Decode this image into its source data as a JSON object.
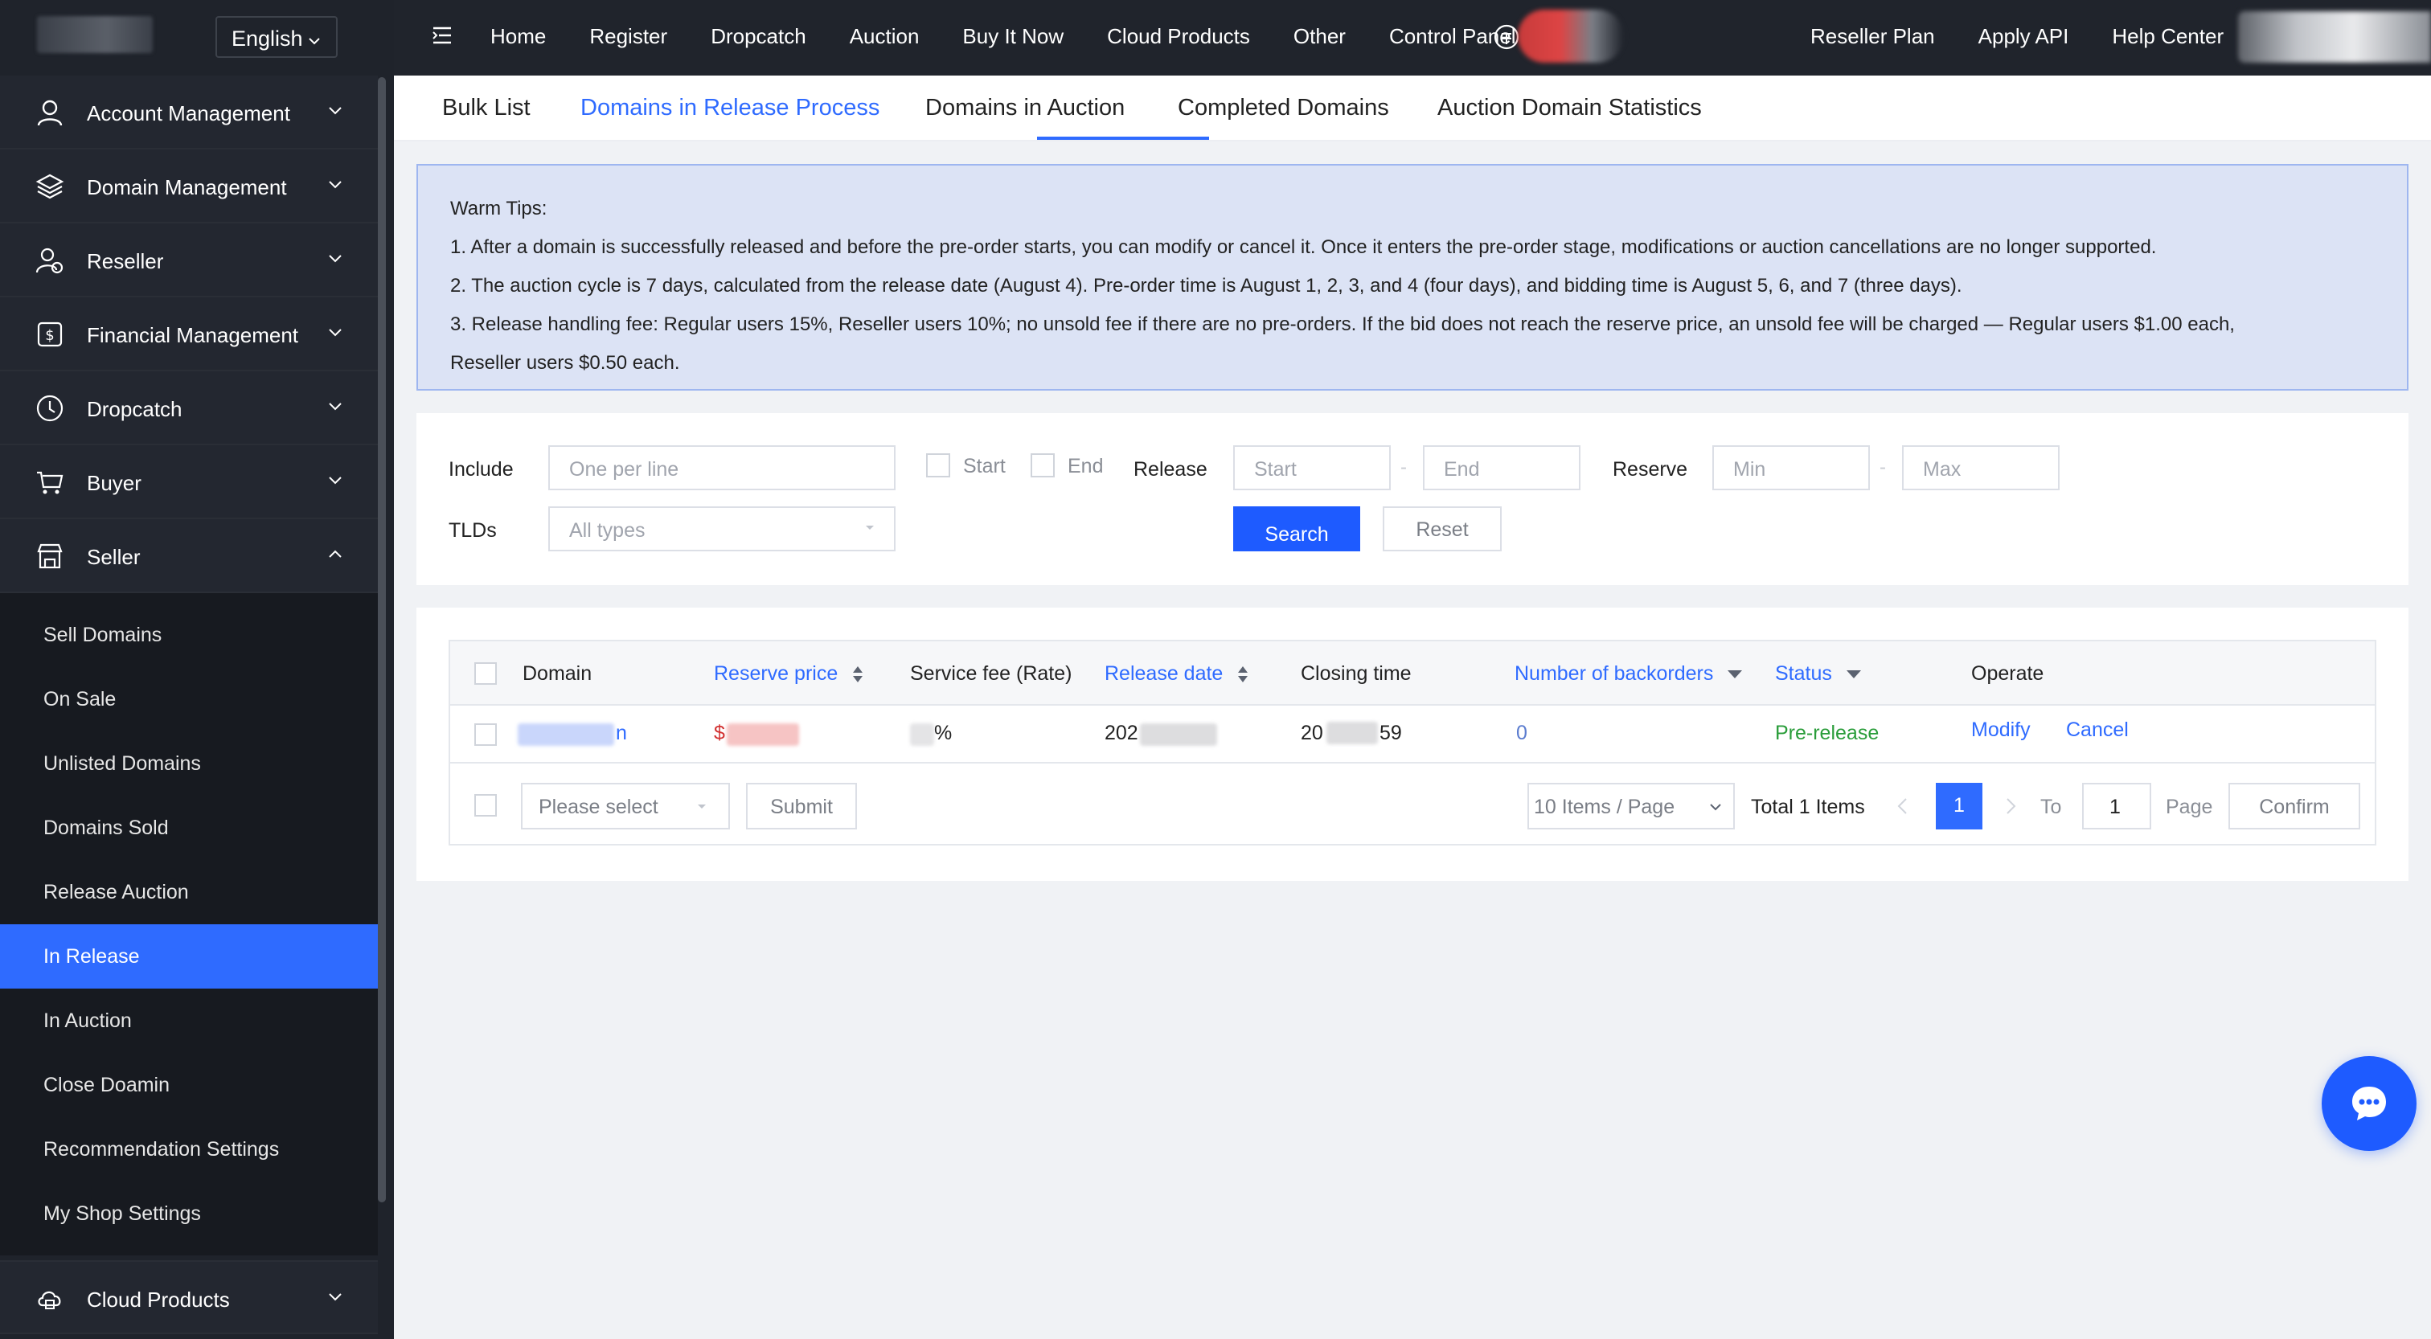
{
  "sidebar": {
    "language": "English",
    "groups": [
      {
        "label": "Account Management",
        "icon": "user-icon"
      },
      {
        "label": "Domain Management",
        "icon": "layers-icon"
      },
      {
        "label": "Reseller",
        "icon": "reseller-icon"
      },
      {
        "label": "Financial Management",
        "icon": "dollar-icon"
      },
      {
        "label": "Dropcatch",
        "icon": "clock-icon"
      },
      {
        "label": "Buyer",
        "icon": "cart-icon"
      },
      {
        "label": "Seller",
        "icon": "store-icon"
      }
    ],
    "seller_items": [
      "Sell Domains",
      "On Sale",
      "Unlisted Domains",
      "Domains Sold",
      "Release Auction",
      "In Release",
      "In Auction",
      "Close Doamin",
      "Recommendation Settings",
      "My Shop Settings"
    ],
    "active_item": "In Release",
    "bottom_group": {
      "label": "Cloud Products",
      "icon": "cloud-icon"
    }
  },
  "topbar": {
    "nav": [
      "Home",
      "Register",
      "Dropcatch",
      "Auction",
      "Buy It Now",
      "Cloud Products",
      "Other",
      "Control Panel"
    ],
    "right": [
      "Reseller Plan",
      "Apply API",
      "Help Center"
    ]
  },
  "tabs": [
    "Bulk List",
    "Domains in Release Process",
    "Domains in Auction",
    "Completed Domains",
    "Auction Domain Statistics"
  ],
  "active_tab": "Domains in Release Process",
  "tips": {
    "title": "Warm Tips:",
    "lines": [
      "1. After a domain is successfully released and before the pre-order starts, you can modify or cancel it. Once it enters the pre-order stage, modifications or auction cancellations are no longer supported.",
      "2. The auction cycle is 7 days, calculated from the release date (August 4). Pre-order time is August 1, 2, 3, and 4 (four days), and bidding time is August 5, 6, and 7 (three days).",
      "3. Release handling fee: Regular users 15%, Reseller users 10%; no unsold fee if there are no pre-orders. If the bid does not reach the reserve price, an unsold fee will be charged — Regular users $1.00 each,",
      "Reseller users $0.50 each."
    ]
  },
  "filters": {
    "include_label": "Include",
    "include_placeholder": "One per line",
    "start_check": "Start",
    "end_check": "End",
    "release_label": "Release",
    "release_start": "Start",
    "release_end": "End",
    "reserve_label": "Reserve",
    "reserve_min": "Min",
    "reserve_max": "Max",
    "tlds_label": "TLDs",
    "tlds_value": "All types",
    "search": "Search",
    "reset": "Reset",
    "dash": "-"
  },
  "table": {
    "columns": [
      "Domain",
      "Reserve price",
      "Service fee (Rate)",
      "Release date",
      "Closing time",
      "Number of backorders",
      "Status",
      "Operate"
    ],
    "rows": [
      {
        "domain_suffix": "n",
        "reserve_prefix": "$",
        "fee_suffix": "%",
        "release_prefix": "202",
        "closing_prefix": "20",
        "closing_suffix": "59",
        "backorders": "0",
        "status": "Pre-release",
        "modify": "Modify",
        "cancel": "Cancel"
      }
    ],
    "footer": {
      "bulk_placeholder": "Please select",
      "submit": "Submit",
      "page_size": "10 Items / Page",
      "total": "Total 1 Items",
      "current_page": "1",
      "to_label": "To",
      "goto_value": "1",
      "page_label": "Page",
      "confirm": "Confirm"
    }
  },
  "colors": {
    "accent": "#2f6bff",
    "status_green": "#2a9d3a",
    "sidebar_bg": "#1f232b",
    "tips_bg": "#dce3f5"
  }
}
